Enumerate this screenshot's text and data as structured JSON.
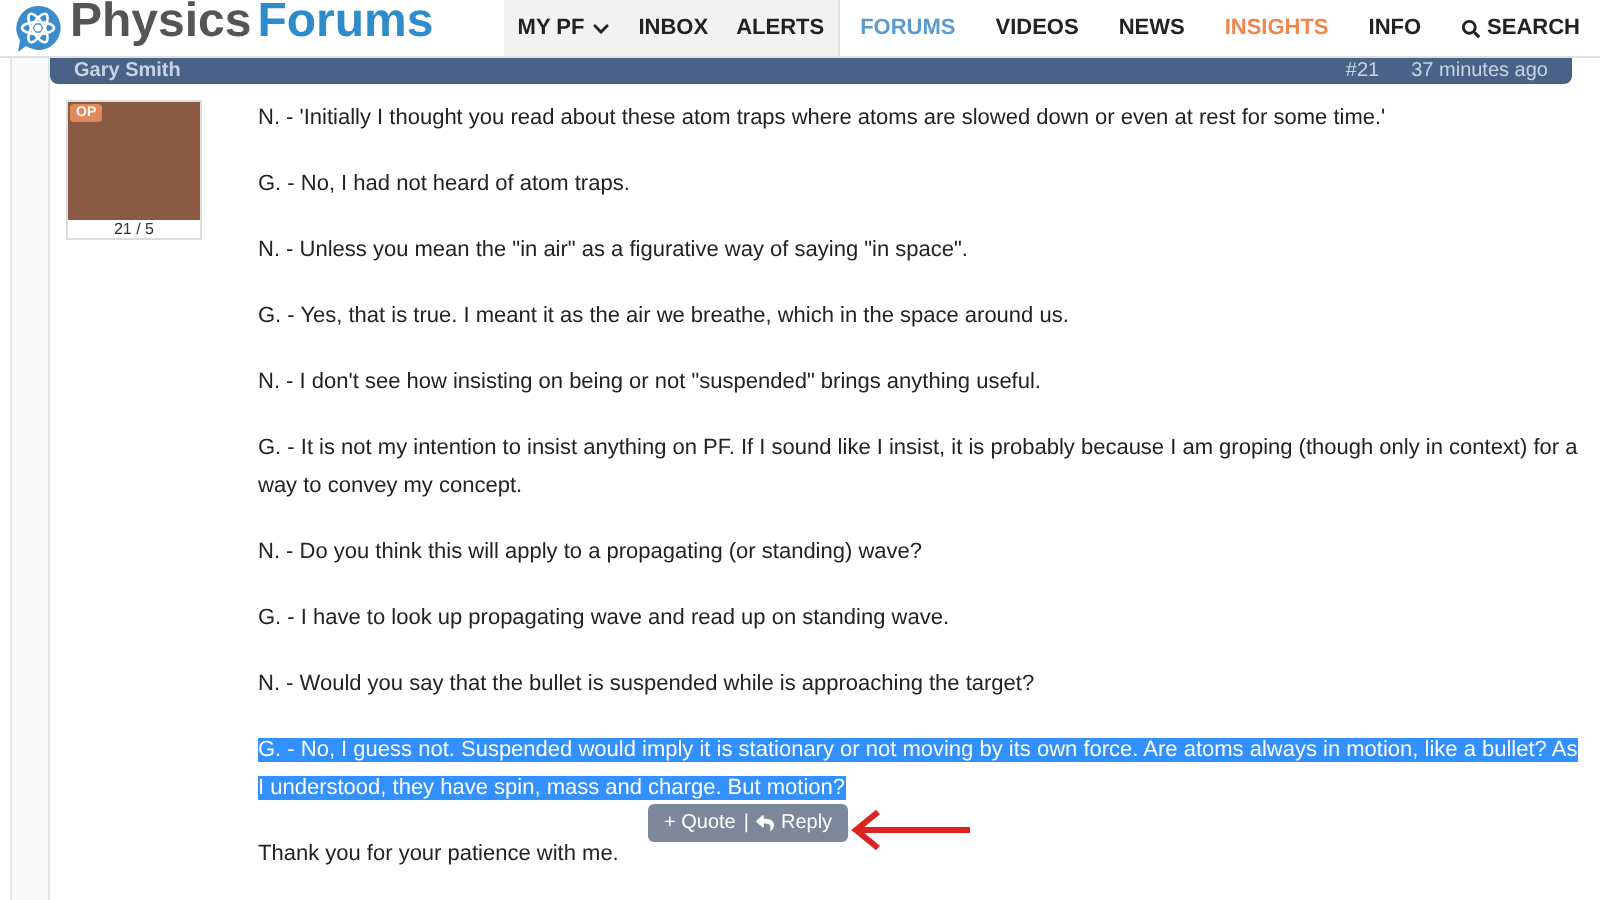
{
  "logo": {
    "word_1": "Physics",
    "word_2": "Forums"
  },
  "nav": [
    {
      "label": "MY PF",
      "kind": "account",
      "selected": false,
      "dropdown": true
    },
    {
      "label": "INBOX",
      "kind": "account",
      "selected": false
    },
    {
      "label": "ALERTS",
      "kind": "account",
      "selected": false
    },
    {
      "label": "FORUMS",
      "kind": "section",
      "selected": true
    },
    {
      "label": "VIDEOS",
      "kind": "section",
      "selected": false
    },
    {
      "label": "NEWS",
      "kind": "section",
      "selected": false
    },
    {
      "label": "INSIGHTS",
      "kind": "featured",
      "selected": false
    },
    {
      "label": "INFO",
      "kind": "section",
      "selected": false
    },
    {
      "label": "SEARCH",
      "kind": "search",
      "selected": false
    }
  ],
  "post": {
    "author": "Gary Smith",
    "number": "#21",
    "time": "37 minutes ago",
    "badge": "OP",
    "stats": "21 / 5",
    "paragraphs": [
      {
        "text": "N. - 'Initially I thought you read about these atom traps where atoms are slowed down or even at rest for some time.'",
        "selected": false
      },
      {
        "text": "G. - No, I had not heard of atom traps.",
        "selected": false
      },
      {
        "text": "N. - Unless you mean the \"in air\" as a figurative way of saying \"in space\".",
        "selected": false
      },
      {
        "text": "G. - Yes, that is true. I meant it as the air we breathe, which in the space around us.",
        "selected": false
      },
      {
        "text": "N. - I don't see how insisting on being or not \"suspended\" brings anything useful.",
        "selected": false
      },
      {
        "text": "G. - It is not my intention to insist anything on PF. If I sound like I insist, it is probably because I am groping (though only in context) for a way to convey my concept.",
        "selected": false
      },
      {
        "text": "N. - Do you think this will apply to a propagating (or standing) wave?",
        "selected": false
      },
      {
        "text": "G. - I have to look up propagating wave and read up on standing wave.",
        "selected": false
      },
      {
        "text": "N. - Would you say that the bullet is suspended while is approaching the target?",
        "selected": false
      },
      {
        "text": "G. - No, I guess not. Suspended would imply it is stationary or not moving by its own force. Are atoms always in motion, like a bullet? As I understood, they have spin, mass and charge. But motion?",
        "selected": true
      },
      {
        "text": "Thank you for your patience with me.",
        "selected": false
      }
    ],
    "popup": {
      "quote": "+ Quote",
      "separator": "|",
      "reply": "Reply"
    }
  }
}
